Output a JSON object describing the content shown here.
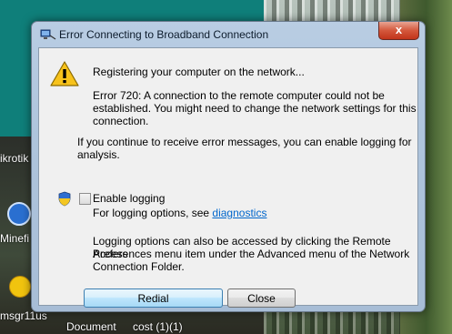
{
  "window": {
    "title": "Error Connecting to Broadband Connection",
    "close_glyph": "x"
  },
  "dialog": {
    "status_text": "Registering your computer on the network...",
    "error_line1": "Error 720: A connection to the remote computer could not be",
    "error_line2": "established.  You might need to change the network settings for this",
    "error_line3": "connection.",
    "logging_hint_line1": "If you continue to receive error messages, you can enable logging for",
    "logging_hint_line2": "analysis.",
    "enable_logging_label": "Enable logging",
    "enable_logging_checked": false,
    "logging_options_prefix": "For logging options, see ",
    "diagnostics_link": "diagnostics",
    "logging_access_line1": "Logging options can also be accessed by clicking the Remote Access",
    "logging_access_line2": "Preferences menu item under the Advanced menu of the Network",
    "logging_access_line3": "Connection Folder.",
    "redial_label": "Redial",
    "close_label": "Close"
  },
  "desktop": {
    "icons": [
      {
        "label": "ikrotik"
      },
      {
        "label": "Minefi"
      },
      {
        "label": "msgr11us"
      },
      {
        "label": "Document"
      },
      {
        "label": "cost (1)(1)"
      }
    ]
  },
  "icons": {
    "title": "network-connection-icon",
    "warning": "warning-icon",
    "shield": "uac-shield-icon",
    "close": "close-icon"
  },
  "colors": {
    "link": "#0066cc",
    "close_button": "#c7452a",
    "teal_background": "#0f7f7a"
  }
}
